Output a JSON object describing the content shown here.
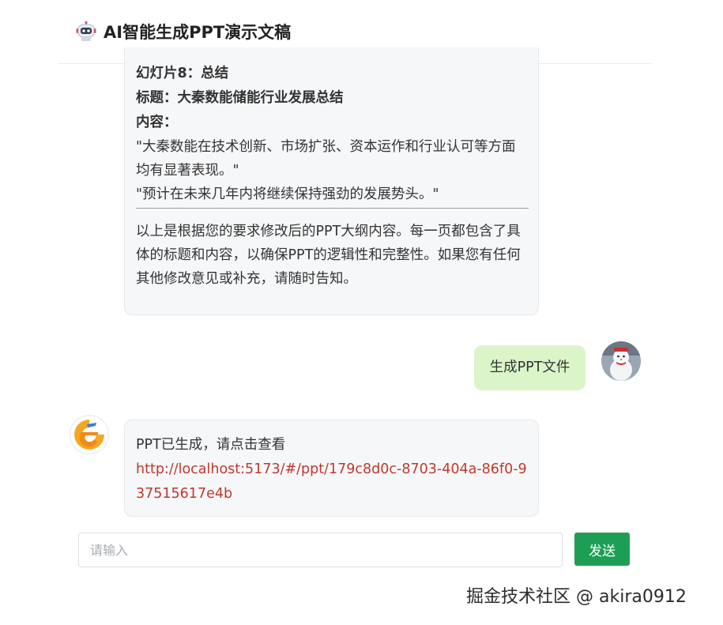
{
  "header": {
    "title": "AI智能生成PPT演示文稿",
    "icon": "robot-icon"
  },
  "outline_message": {
    "slide_heading": "幻灯片8：总结",
    "slide_title": "标题：大秦数能储能行业发展总结",
    "content_label": "内容：",
    "bullet_1": "\"大秦数能在技术创新、市场扩张、资本运作和行业认可等方面均有显著表现。\"",
    "bullet_2": "\"预计在未来几年内将继续保持强劲的发展势头。\"",
    "closing_text": "以上是根据您的要求修改后的PPT大纲内容。每一页都包含了具体的标题和内容，以确保PPT的逻辑性和完整性。如果您有任何其他修改意见或补充，请随时告知。"
  },
  "user_message": {
    "text": "生成PPT文件",
    "bubble_color": "#dbf5c9"
  },
  "ppt_message": {
    "text": "PPT已生成，请点击查看",
    "link": "http://localhost:5173/#/ppt/179c8d0c-8703-404a-86f0-937515617e4b",
    "link_color": "#c0392b"
  },
  "composer": {
    "placeholder": "请输入",
    "value": "",
    "send_label": "发送",
    "send_color": "#1e9e55"
  },
  "watermark": {
    "text": "掘金技术社区 @ akira0912"
  }
}
